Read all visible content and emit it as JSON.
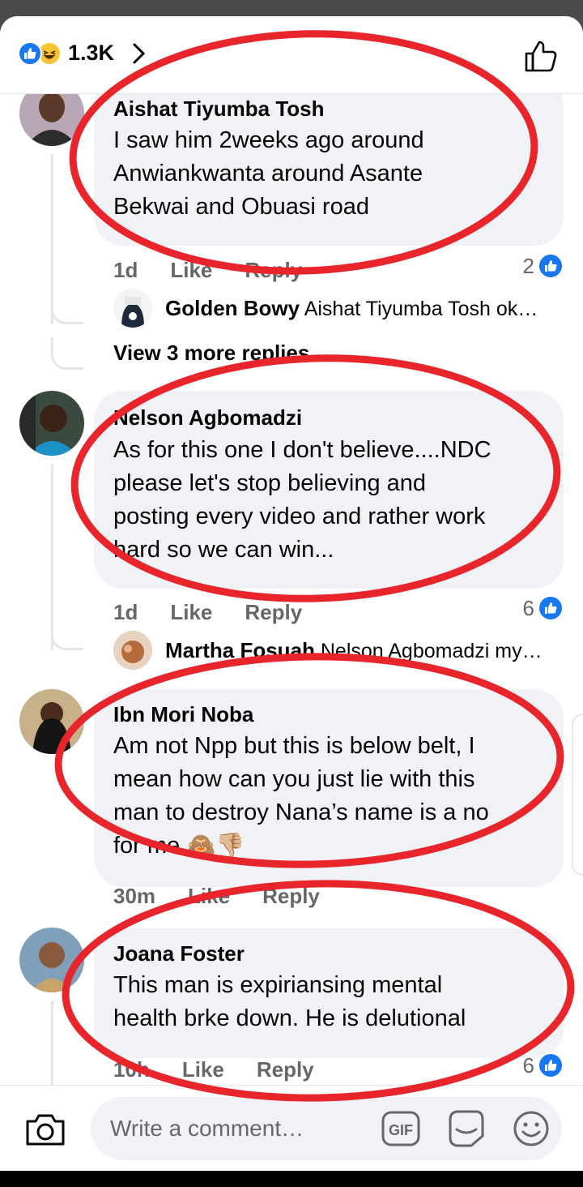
{
  "header": {
    "reaction_count": "1.3K",
    "reactions": [
      "like-icon",
      "haha-icon"
    ]
  },
  "comments": [
    {
      "author": "Aishat Tiyumba Tosh",
      "lines": [
        "I saw him 2weeks ago around",
        "Anwiankwanta around Asante",
        "Bekwai and Obuasi road"
      ],
      "time": "1d",
      "like_label": "Like",
      "reply_label": "Reply",
      "reactions": "2",
      "reply_preview": {
        "author": "Golden Bowy",
        "text": "Aishat Tiyumba Tosh ok…"
      },
      "view_more": "View 3 more replies..."
    },
    {
      "author": "Nelson Agbomadzi",
      "lines": [
        "As for this one I don't believe....NDC",
        "please let's stop believing and",
        "posting every video and rather work",
        "hard so we can win..."
      ],
      "time": "1d",
      "like_label": "Like",
      "reply_label": "Reply",
      "reactions": "6",
      "reply_preview": {
        "author": "Martha Fosuah",
        "text": "Nelson Agbomadzi my…"
      }
    },
    {
      "author": "Ibn Mori Noba",
      "lines": [
        "Am not Npp but this is below belt, I",
        "mean how can you just lie with this",
        "man to destroy Nana’s name is a no",
        "for me 🙈👎🏼"
      ],
      "time": "30m",
      "like_label": "Like",
      "reply_label": "Reply"
    },
    {
      "author": "Joana Foster",
      "lines": [
        "This man is expiriansing mental",
        "health brke down. He is delutional"
      ],
      "time": "10h",
      "like_label": "Like",
      "reply_label": "Reply",
      "reactions": "6"
    }
  ],
  "composer": {
    "placeholder": "Write a comment…",
    "gif_label": "GIF"
  },
  "colors": {
    "accent": "#1877f2",
    "annotation": "#e8252b",
    "bubble": "#f0f2f5",
    "meta_text": "#65676b"
  }
}
